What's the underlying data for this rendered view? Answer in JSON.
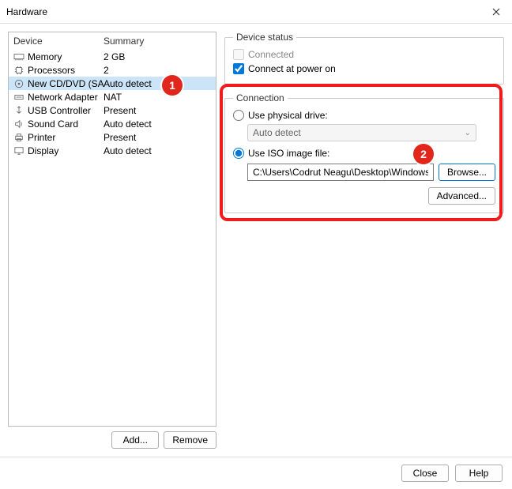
{
  "window": {
    "title": "Hardware"
  },
  "list": {
    "headers": {
      "device": "Device",
      "summary": "Summary"
    },
    "rows": [
      {
        "name": "Memory",
        "summary": "2 GB",
        "icon": "memory-icon"
      },
      {
        "name": "Processors",
        "summary": "2",
        "icon": "cpu-icon"
      },
      {
        "name": "New CD/DVD (SATA)",
        "summary": "Auto detect",
        "icon": "cd-icon",
        "selected": true
      },
      {
        "name": "Network Adapter",
        "summary": "NAT",
        "icon": "network-icon"
      },
      {
        "name": "USB Controller",
        "summary": "Present",
        "icon": "usb-icon"
      },
      {
        "name": "Sound Card",
        "summary": "Auto detect",
        "icon": "sound-icon"
      },
      {
        "name": "Printer",
        "summary": "Present",
        "icon": "printer-icon"
      },
      {
        "name": "Display",
        "summary": "Auto detect",
        "icon": "display-icon"
      }
    ]
  },
  "leftButtons": {
    "add": "Add...",
    "remove": "Remove"
  },
  "deviceStatus": {
    "legend": "Device status",
    "connected": "Connected",
    "connectAtPowerOn": "Connect at power on",
    "connectedChecked": false,
    "connectAtPowerOnChecked": true
  },
  "connection": {
    "legend": "Connection",
    "usePhysical": "Use physical drive:",
    "physicalDriveValue": "Auto detect",
    "useIso": "Use ISO image file:",
    "isoPath": "C:\\Users\\Codrut Neagu\\Desktop\\Windows.iso",
    "browse": "Browse...",
    "advanced": "Advanced...",
    "selectedOption": "iso"
  },
  "footer": {
    "close": "Close",
    "help": "Help"
  },
  "callouts": {
    "one": "1",
    "two": "2"
  }
}
